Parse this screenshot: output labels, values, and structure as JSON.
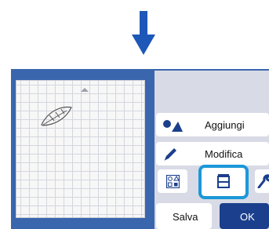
{
  "arrow": {
    "icon": "down-arrow-icon",
    "color": "#1d58b8"
  },
  "screen": {
    "frame_color": "#3a66ad",
    "panel_color": "#d8dbe6",
    "accent_color": "#1c98d8"
  },
  "mat": {
    "icon": "leaf-icon"
  },
  "buttons": {
    "add_label": "Aggiungi",
    "add_icon": "shapes-icon",
    "edit_label": "Modifica",
    "edit_icon": "pen-icon",
    "layout_icon": "layout-icon",
    "cut_area_icon": "cut-area-icon",
    "settings_icon": "wrench-icon",
    "save_label": "Salva",
    "ok_label": "OK"
  }
}
